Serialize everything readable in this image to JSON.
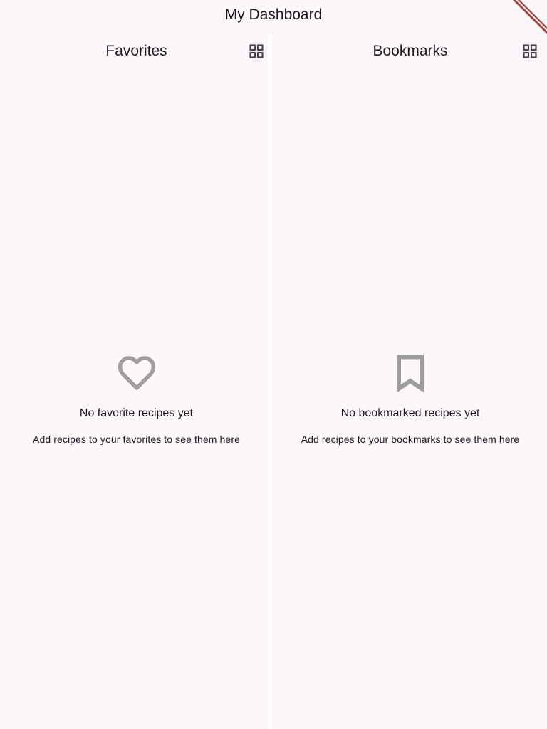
{
  "app": {
    "title": "My Dashboard"
  },
  "favorites": {
    "title": "Favorites",
    "toggle_icon": "grid-view-icon",
    "empty_icon": "heart-outline-icon",
    "empty_title": "No favorite recipes yet",
    "empty_subtitle": "Add recipes to your favorites to see them here"
  },
  "bookmarks": {
    "title": "Bookmarks",
    "toggle_icon": "grid-view-icon",
    "empty_icon": "bookmark-outline-icon",
    "empty_subtitle": "Add recipes to your bookmarks to see them here",
    "empty_title": "No bookmarked recipes yet"
  },
  "colors": {
    "background": "#fdf7fb",
    "icon_gray": "#9e9e9e",
    "grid_icon": "#49454f",
    "banner": "#a0413d"
  }
}
